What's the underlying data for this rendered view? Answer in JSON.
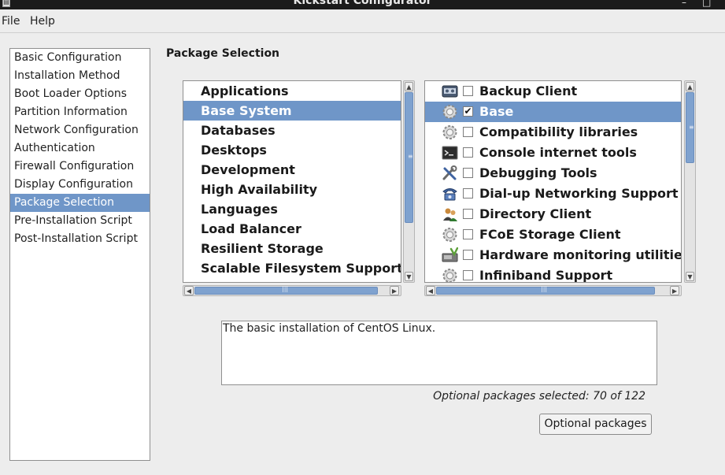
{
  "window": {
    "title": "Kickstart Configurator"
  },
  "menubar": {
    "file": "File",
    "help": "Help"
  },
  "nav": {
    "items": [
      "Basic Configuration",
      "Installation Method",
      "Boot Loader Options",
      "Partition Information",
      "Network Configuration",
      "Authentication",
      "Firewall Configuration",
      "Display Configuration",
      "Package Selection",
      "Pre-Installation Script",
      "Post-Installation Script"
    ],
    "selected": "Package Selection"
  },
  "main": {
    "section_title": "Package Selection",
    "groups": [
      "Applications",
      "Base System",
      "Databases",
      "Desktops",
      "Development",
      "High Availability",
      "Languages",
      "Load Balancer",
      "Resilient Storage",
      "Scalable Filesystem Support"
    ],
    "selected_group": "Base System",
    "packages": [
      {
        "label": "Backup Client",
        "checked": false,
        "icon": "tape-drive-icon"
      },
      {
        "label": "Base",
        "checked": true,
        "icon": "gear-icon"
      },
      {
        "label": "Compatibility libraries",
        "checked": false,
        "icon": "gear-icon"
      },
      {
        "label": "Console internet tools",
        "checked": false,
        "icon": "terminal-icon"
      },
      {
        "label": "Debugging Tools",
        "checked": false,
        "icon": "tools-icon"
      },
      {
        "label": "Dial-up Networking Support",
        "checked": false,
        "icon": "telephone-icon"
      },
      {
        "label": "Directory Client",
        "checked": false,
        "icon": "users-icon"
      },
      {
        "label": "FCoE Storage Client",
        "checked": false,
        "icon": "gear-icon"
      },
      {
        "label": "Hardware monitoring utilities",
        "checked": false,
        "icon": "hardware-monitor-icon"
      },
      {
        "label": "Infiniband Support",
        "checked": false,
        "icon": "gear-icon"
      }
    ],
    "selected_package": "Base",
    "description": "The basic installation of CentOS Linux.",
    "optional_info": "Optional packages selected: 70 of 122",
    "optional_button": "Optional packages"
  },
  "colors": {
    "selection": "#6f96c8",
    "titlebar": "#1b1b1b",
    "background": "#ededed"
  }
}
